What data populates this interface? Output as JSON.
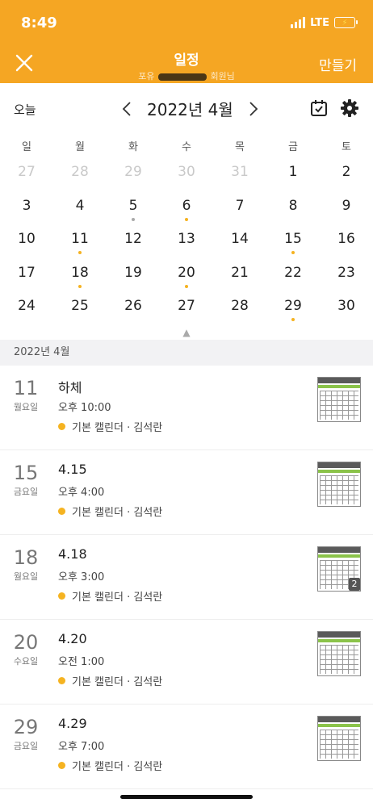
{
  "status_bar": {
    "time": "8:49",
    "network": "LTE"
  },
  "header": {
    "title": "일정",
    "subtitle_left": "포유",
    "subtitle_right": "회원님",
    "create_label": "만들기"
  },
  "calendar_bar": {
    "today_label": "오늘",
    "month_title": "2022년 4월"
  },
  "weekdays": [
    "일",
    "월",
    "화",
    "수",
    "목",
    "금",
    "토"
  ],
  "weeks": [
    [
      {
        "d": "27",
        "muted": true
      },
      {
        "d": "28",
        "muted": true
      },
      {
        "d": "29",
        "muted": true
      },
      {
        "d": "30",
        "muted": true
      },
      {
        "d": "31",
        "muted": true
      },
      {
        "d": "1"
      },
      {
        "d": "2"
      }
    ],
    [
      {
        "d": "3"
      },
      {
        "d": "4"
      },
      {
        "d": "5",
        "dot": "#aaaaaa"
      },
      {
        "d": "6",
        "dot": "#f5b321"
      },
      {
        "d": "7"
      },
      {
        "d": "8"
      },
      {
        "d": "9"
      }
    ],
    [
      {
        "d": "10"
      },
      {
        "d": "11",
        "dot": "#f5b321"
      },
      {
        "d": "12"
      },
      {
        "d": "13"
      },
      {
        "d": "14"
      },
      {
        "d": "15",
        "dot": "#f5b321"
      },
      {
        "d": "16"
      }
    ],
    [
      {
        "d": "17"
      },
      {
        "d": "18",
        "dot": "#f5b321"
      },
      {
        "d": "19"
      },
      {
        "d": "20",
        "dot": "#f5b321"
      },
      {
        "d": "21"
      },
      {
        "d": "22"
      },
      {
        "d": "23"
      }
    ],
    [
      {
        "d": "24"
      },
      {
        "d": "25"
      },
      {
        "d": "26"
      },
      {
        "d": "27"
      },
      {
        "d": "28"
      },
      {
        "d": "29",
        "dot": "#f5b321"
      },
      {
        "d": "30"
      }
    ]
  ],
  "section_label": "2022년 4월",
  "events": [
    {
      "day": "11",
      "dow": "월요일",
      "title": "하체",
      "time": "오후 10:00",
      "calendar": "기본 캘린더 · 김석란",
      "badge": ""
    },
    {
      "day": "15",
      "dow": "금요일",
      "title": "4.15",
      "time": "오후 4:00",
      "calendar": "기본 캘린더 · 김석란",
      "badge": ""
    },
    {
      "day": "18",
      "dow": "월요일",
      "title": "4.18",
      "time": "오후 3:00",
      "calendar": "기본 캘린더 · 김석란",
      "badge": "2"
    },
    {
      "day": "20",
      "dow": "수요일",
      "title": "4.20",
      "time": "오전 1:00",
      "calendar": "기본 캘린더 · 김석란",
      "badge": ""
    },
    {
      "day": "29",
      "dow": "금요일",
      "title": "4.29",
      "time": "오후 7:00",
      "calendar": "기본 캘린더 · 김석란",
      "badge": ""
    }
  ],
  "colors": {
    "accent": "#f5a623",
    "event_dot": "#f5b321"
  },
  "icons": {
    "close": "close-icon",
    "prev": "chevron-left-icon",
    "next": "chevron-right-icon",
    "calendar_check": "calendar-check-icon",
    "settings": "gear-icon"
  }
}
